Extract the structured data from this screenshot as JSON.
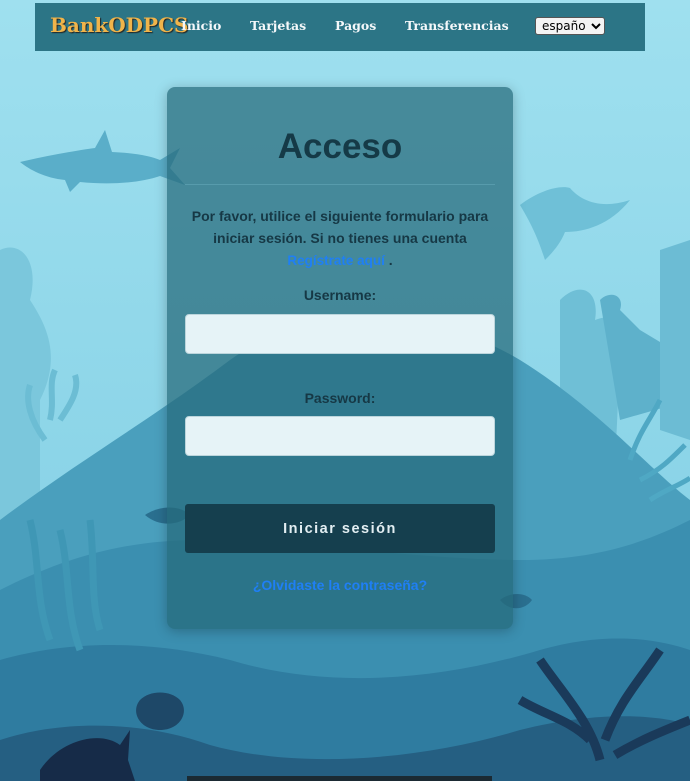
{
  "navbar": {
    "brand": "BankODPCS",
    "links": [
      "Inicio",
      "Tarjetas",
      "Pagos",
      "Transferencias"
    ],
    "language": {
      "selected": "español"
    },
    "background_color": "#2c7586",
    "brand_color": "#f0b44a"
  },
  "login": {
    "title": "Acceso",
    "intro_text": "Por favor, utilice el siguiente formulario para iniciar sesión. Si no tienes una cuenta",
    "register_link": "Regístrate aquí",
    "register_suffix": ".",
    "username_label": "Username:",
    "username_value": "",
    "password_label": "Password:",
    "password_value": "",
    "submit_label": "Iniciar sesión",
    "forgot_link": "¿Olvidaste la contraseña?",
    "link_color": "#1f7ff5",
    "button_color": "#153f4e"
  },
  "background": {
    "theme": "underwater-reef-illustration",
    "water_color": "#9adcec"
  }
}
